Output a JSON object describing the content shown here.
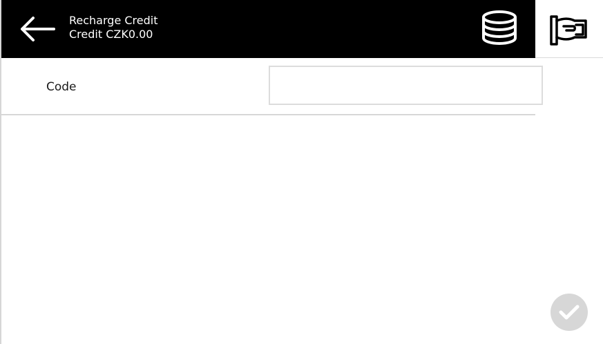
{
  "header": {
    "title": "Recharge Credit",
    "subtitle": "Credit CZK0.00",
    "back_icon": "arrow-left-icon",
    "coins_icon": "coins-stack-icon",
    "background": "#000000",
    "text_color": "#ffffff"
  },
  "side_panel": {
    "top_icon": "hand-holding-card-icon",
    "confirm_icon": "checkmark-icon",
    "confirm_color": "#d7d7d7"
  },
  "form": {
    "code_label": "Code",
    "code_value": "",
    "code_placeholder": ""
  }
}
